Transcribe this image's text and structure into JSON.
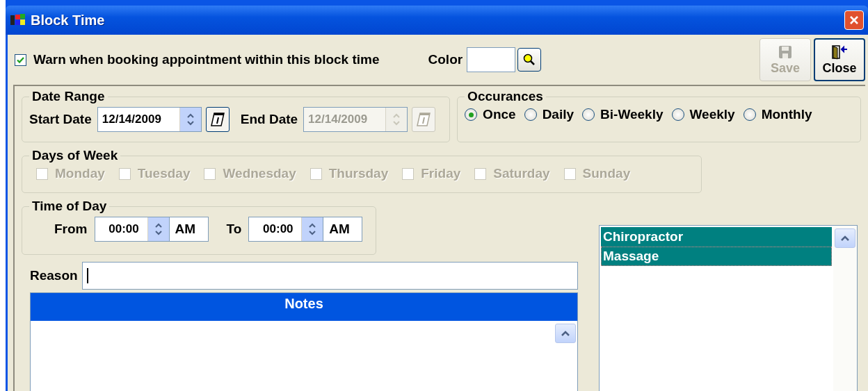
{
  "window": {
    "title": "Block Time"
  },
  "warn": {
    "label": "Warn when booking appointment within this block time",
    "checked": true
  },
  "color": {
    "label": "Color"
  },
  "buttons": [
    {
      "kind": "save",
      "label": "Save",
      "disabled": true
    },
    {
      "kind": "close",
      "label": "Close",
      "disabled": false
    }
  ],
  "date_range": {
    "title": "Date Range",
    "start": {
      "label": "Start Date",
      "value": "12/14/2009",
      "disabled": false
    },
    "end": {
      "label": "End Date",
      "value": "12/14/2009",
      "disabled": true
    }
  },
  "occurances": {
    "title": "Occurances",
    "options": [
      {
        "label": "Once",
        "selected": true
      },
      {
        "label": "Daily",
        "selected": false
      },
      {
        "label": "Bi-Weekly",
        "selected": false
      },
      {
        "label": "Weekly",
        "selected": false
      },
      {
        "label": "Monthly",
        "selected": false
      }
    ]
  },
  "days_of_week": {
    "title": "Days of Week",
    "disabled": true,
    "days": [
      {
        "label": "Monday",
        "checked": false
      },
      {
        "label": "Tuesday",
        "checked": false
      },
      {
        "label": "Wednesday",
        "checked": false
      },
      {
        "label": "Thursday",
        "checked": false
      },
      {
        "label": "Friday",
        "checked": false
      },
      {
        "label": "Saturday",
        "checked": false
      },
      {
        "label": "Sunday",
        "checked": false
      }
    ]
  },
  "time_of_day": {
    "title": "Time of Day",
    "from": {
      "label": "From",
      "time": "00:00",
      "ampm": "AM"
    },
    "to": {
      "label": "To",
      "time": "00:00",
      "ampm": "AM"
    }
  },
  "reason": {
    "label": "Reason"
  },
  "notes": {
    "title": "Notes"
  },
  "services": [
    {
      "label": "Chiropractor",
      "selected": true
    },
    {
      "label": "Massage",
      "selected": true
    }
  ]
}
